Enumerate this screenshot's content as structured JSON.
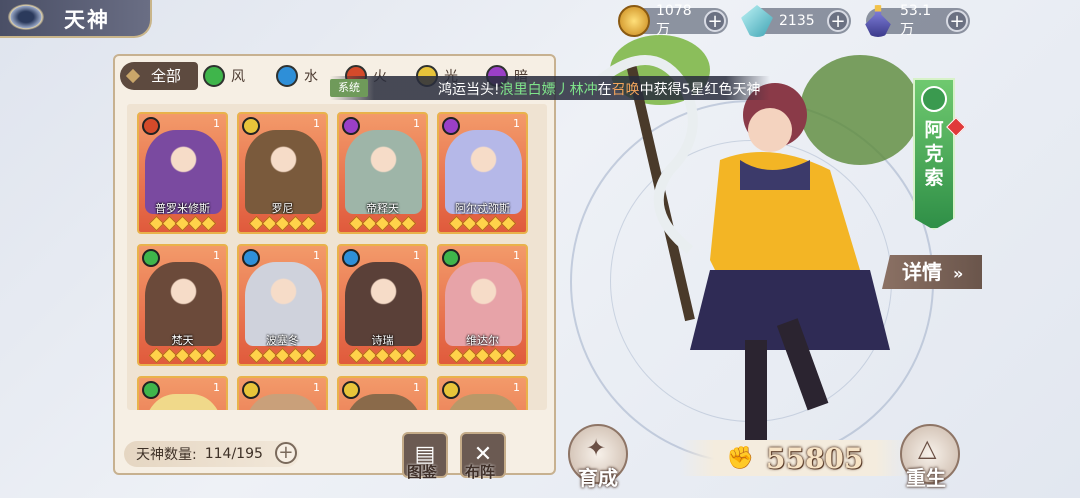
{
  "header": {
    "title": "天神"
  },
  "resources": [
    {
      "value": "1078万",
      "icon": "gold-coin-icon",
      "color": "#e1a52a"
    },
    {
      "value": "2135",
      "icon": "crystal-icon",
      "color": "#6ed1d8"
    },
    {
      "value": "53.1万",
      "icon": "potion-icon",
      "color": "#7c7bd6"
    }
  ],
  "tabs": {
    "all": "全部",
    "elements": [
      {
        "label": "风",
        "color": "#3fb54b"
      },
      {
        "label": "水",
        "color": "#2e8fd8"
      },
      {
        "label": "火",
        "color": "#d44a2a"
      },
      {
        "label": "光",
        "color": "#e8c43a"
      },
      {
        "label": "暗",
        "color": "#9a3fc7"
      }
    ]
  },
  "banner": {
    "tag": "系统",
    "prefix": "鸿运当头!",
    "player": "浪里白嫖丿林冲",
    "mid1": "在",
    "action": "召唤",
    "mid2": "中获得5星红色天神"
  },
  "heroes": [
    {
      "name": "普罗米修斯",
      "level": "1",
      "element_color": "#d44a2a",
      "portrait": "#7a4aa0"
    },
    {
      "name": "罗尼",
      "level": "1",
      "element_color": "#e8c43a",
      "portrait": "#7a5a3c"
    },
    {
      "name": "帝释天",
      "level": "1",
      "element_color": "#9a3fc7",
      "portrait": "#9eb5a8"
    },
    {
      "name": "阿尔忒弥斯",
      "level": "1",
      "element_color": "#9a3fc7",
      "portrait": "#b5b8e8"
    },
    {
      "name": "梵天",
      "level": "1",
      "element_color": "#3fb54b",
      "portrait": "#6b4a3a"
    },
    {
      "name": "波塞冬",
      "level": "1",
      "element_color": "#2e8fd8",
      "portrait": "#cfd2dc"
    },
    {
      "name": "诗瑞",
      "level": "1",
      "element_color": "#2e8fd8",
      "portrait": "#5a4038"
    },
    {
      "name": "维达尔",
      "level": "1",
      "element_color": "#3fb54b",
      "portrait": "#e7a3a8"
    },
    {
      "name": "",
      "level": "1",
      "element_color": "#3fb54b",
      "portrait": "#f0d98a"
    },
    {
      "name": "",
      "level": "1",
      "element_color": "#e8c43a",
      "portrait": "#c9a07a"
    },
    {
      "name": "",
      "level": "1",
      "element_color": "#e8c43a",
      "portrait": "#8a6a4a"
    },
    {
      "name": "",
      "level": "1",
      "element_color": "#e8c43a",
      "portrait": "#b99868"
    }
  ],
  "footer": {
    "count_label": "天神数量:",
    "count_value": "114/195",
    "atlas": "图鉴",
    "formation": "布阵"
  },
  "character": {
    "name": "阿克索",
    "detail": "详情",
    "power": "55805",
    "develop": "育成",
    "rebirth": "重生"
  }
}
